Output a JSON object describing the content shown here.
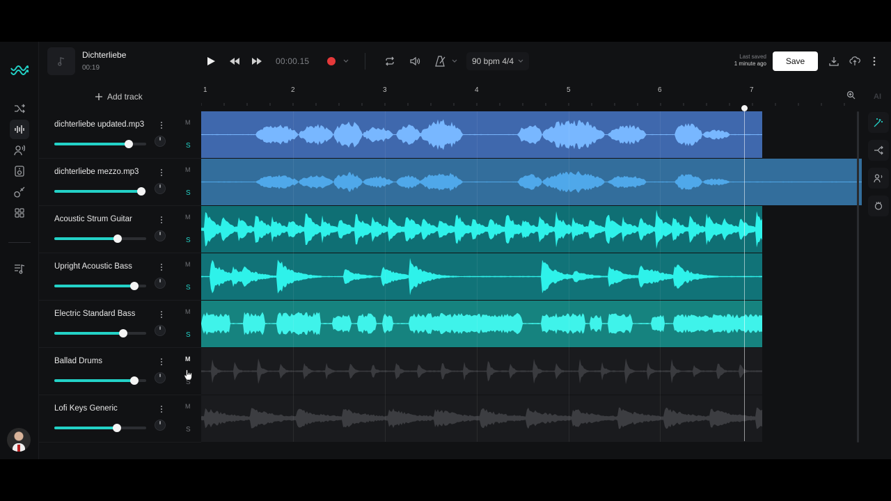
{
  "project": {
    "name": "Dichterliebe",
    "duration": "00:19"
  },
  "transport": {
    "timecode": "00:00.15",
    "tempo": "90 bpm 4/4"
  },
  "header": {
    "last_saved_label": "Last saved",
    "last_saved_value": "1 minute ago",
    "save_label": "Save"
  },
  "add_track_label": "Add track",
  "ruler": [
    "1",
    "2",
    "3",
    "4",
    "5",
    "6",
    "7"
  ],
  "ai_label": "AI",
  "colors": {
    "accent": "#23d2c7",
    "record": "#e5393a",
    "blue_clip": "#4a78c2",
    "blue_wave": "#78b7ff",
    "teal_clip_bg": "#137e83",
    "teal_wave": "#2ef2ea"
  },
  "tracks": [
    {
      "name": "dichterliebe updated.mp3",
      "mute": "M",
      "solo": "S",
      "volume": 0.81
    },
    {
      "name": "dichterliebe mezzo.mp3",
      "mute": "M",
      "solo": "S",
      "volume": 0.95
    },
    {
      "name": "Acoustic Strum Guitar",
      "mute": "M",
      "solo": "S",
      "volume": 0.69
    },
    {
      "name": "Upright Acoustic Bass",
      "mute": "M",
      "solo": "S",
      "volume": 0.87
    },
    {
      "name": "Electric Standard Bass",
      "mute": "M",
      "solo": "S",
      "volume": 0.75
    },
    {
      "name": "Ballad Drums",
      "mute": "M",
      "solo": "S",
      "volume": 0.87
    },
    {
      "name": "Lofi Keys Generic",
      "mute": "M",
      "solo": "S",
      "volume": 0.68
    }
  ],
  "icons": {
    "logo": "waves-logo-icon",
    "rail": [
      "shuffle-icon",
      "waveform-icon",
      "voice-icon",
      "speaker-icon",
      "guitar-icon",
      "grid-icon",
      "music-list-icon"
    ],
    "transport": [
      "play-icon",
      "rewind-icon",
      "fast-forward-icon",
      "record-icon",
      "loop-icon",
      "volume-icon",
      "metronome-icon"
    ],
    "right_panel": [
      "magic-icon",
      "split-icon",
      "voice-icon",
      "mastering-icon",
      "zoom-icon"
    ]
  }
}
